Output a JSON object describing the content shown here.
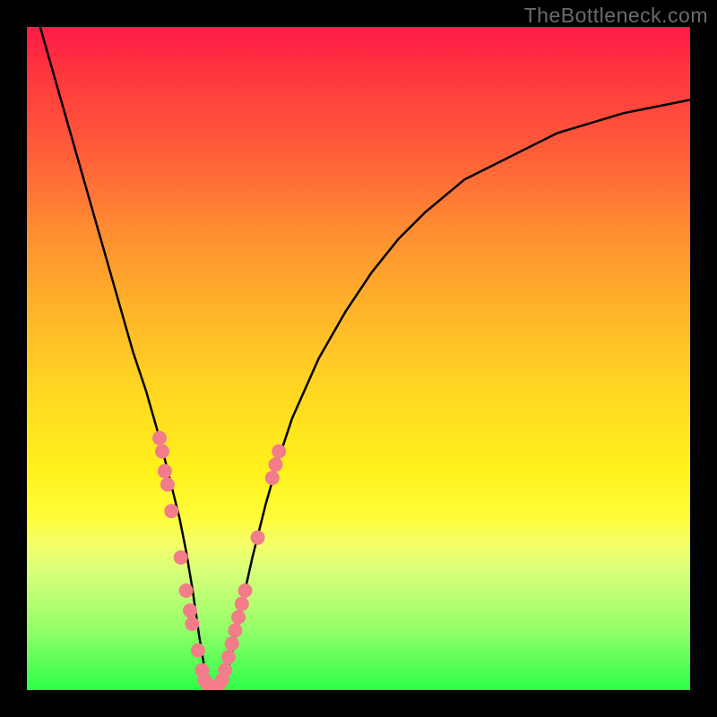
{
  "attribution": "TheBottleneck.com",
  "chart_data": {
    "type": "line",
    "title": "",
    "xlabel": "",
    "ylabel": "",
    "xlim": [
      0,
      100
    ],
    "ylim": [
      0,
      100
    ],
    "background_gradient": {
      "top": "#ff1a47",
      "bottom": "#2dff4a",
      "meaning": "red = high bottleneck, green = low bottleneck"
    },
    "series": [
      {
        "name": "bottleneck-curve",
        "x": [
          2,
          4,
          6,
          8,
          10,
          12,
          14,
          16,
          18,
          20,
          21,
          22,
          23,
          24,
          25,
          26,
          27,
          28,
          29,
          30,
          31,
          32,
          34,
          36,
          38,
          40,
          44,
          48,
          52,
          56,
          60,
          66,
          72,
          80,
          90,
          100
        ],
        "y": [
          100,
          93,
          86,
          79,
          72,
          65,
          58,
          51,
          45,
          38,
          34,
          30,
          26,
          21,
          15,
          8,
          2,
          0,
          0,
          2,
          6,
          11,
          20,
          28,
          35,
          41,
          50,
          57,
          63,
          68,
          72,
          77,
          80,
          84,
          87,
          89
        ]
      }
    ],
    "markers": {
      "name": "sample-points",
      "note": "salmon dots clustered near curve bottom",
      "points": [
        {
          "x": 20.0,
          "y": 38
        },
        {
          "x": 20.4,
          "y": 36
        },
        {
          "x": 20.8,
          "y": 33
        },
        {
          "x": 21.2,
          "y": 31
        },
        {
          "x": 21.8,
          "y": 27
        },
        {
          "x": 23.2,
          "y": 20
        },
        {
          "x": 24.0,
          "y": 15
        },
        {
          "x": 24.6,
          "y": 12
        },
        {
          "x": 24.9,
          "y": 10
        },
        {
          "x": 25.8,
          "y": 6
        },
        {
          "x": 26.4,
          "y": 3
        },
        {
          "x": 26.8,
          "y": 1.5
        },
        {
          "x": 27.3,
          "y": 0.8
        },
        {
          "x": 27.7,
          "y": 0.3
        },
        {
          "x": 28.2,
          "y": 0.2
        },
        {
          "x": 28.8,
          "y": 0.6
        },
        {
          "x": 29.4,
          "y": 1.5
        },
        {
          "x": 29.9,
          "y": 3
        },
        {
          "x": 30.4,
          "y": 5
        },
        {
          "x": 30.9,
          "y": 7
        },
        {
          "x": 31.4,
          "y": 9
        },
        {
          "x": 31.9,
          "y": 11
        },
        {
          "x": 32.4,
          "y": 13
        },
        {
          "x": 32.9,
          "y": 15
        },
        {
          "x": 34.8,
          "y": 23
        },
        {
          "x": 37.0,
          "y": 32
        },
        {
          "x": 37.5,
          "y": 34
        },
        {
          "x": 38.0,
          "y": 36
        }
      ]
    }
  }
}
